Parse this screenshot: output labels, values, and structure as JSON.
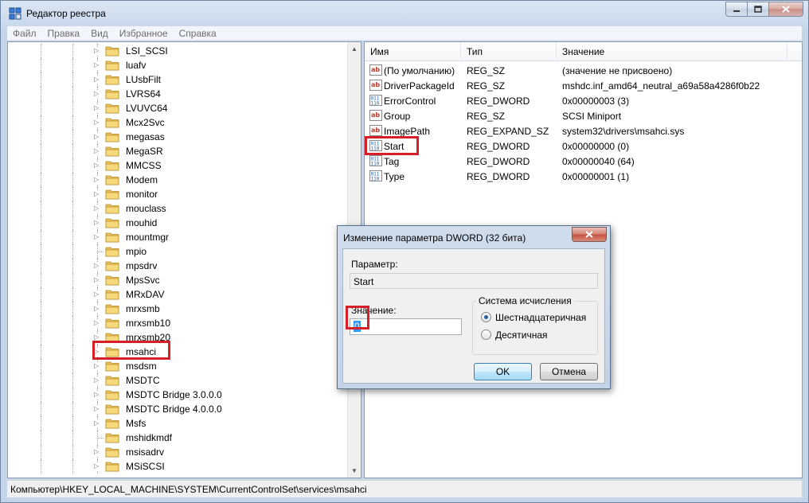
{
  "window": {
    "title": "Редактор реестра",
    "buttons": [
      "minimize",
      "maximize",
      "close"
    ]
  },
  "menu": [
    "Файл",
    "Правка",
    "Вид",
    "Избранное",
    "Справка"
  ],
  "tree": {
    "items": [
      {
        "label": "LSI_SCSI",
        "expandable": true
      },
      {
        "label": "luafv",
        "expandable": true
      },
      {
        "label": "LUsbFilt",
        "expandable": true
      },
      {
        "label": "LVRS64",
        "expandable": true
      },
      {
        "label": "LVUVC64",
        "expandable": true
      },
      {
        "label": "Mcx2Svc",
        "expandable": true
      },
      {
        "label": "megasas",
        "expandable": true
      },
      {
        "label": "MegaSR",
        "expandable": true
      },
      {
        "label": "MMCSS",
        "expandable": true
      },
      {
        "label": "Modem",
        "expandable": true
      },
      {
        "label": "monitor",
        "expandable": true
      },
      {
        "label": "mouclass",
        "expandable": true
      },
      {
        "label": "mouhid",
        "expandable": true
      },
      {
        "label": "mountmgr",
        "expandable": true
      },
      {
        "label": "mpio",
        "expandable": false
      },
      {
        "label": "mpsdrv",
        "expandable": true
      },
      {
        "label": "MpsSvc",
        "expandable": true
      },
      {
        "label": "MRxDAV",
        "expandable": true
      },
      {
        "label": "mrxsmb",
        "expandable": true
      },
      {
        "label": "mrxsmb10",
        "expandable": true
      },
      {
        "label": "mrxsmb20",
        "expandable": true
      },
      {
        "label": "msahci",
        "expandable": true,
        "selected": true
      },
      {
        "label": "msdsm",
        "expandable": true
      },
      {
        "label": "MSDTC",
        "expandable": true
      },
      {
        "label": "MSDTC Bridge 3.0.0.0",
        "expandable": true
      },
      {
        "label": "MSDTC Bridge 4.0.0.0",
        "expandable": true
      },
      {
        "label": "Msfs",
        "expandable": true
      },
      {
        "label": "mshidkmdf",
        "expandable": false
      },
      {
        "label": "msisadrv",
        "expandable": true
      },
      {
        "label": "MSiSCSI",
        "expandable": true
      }
    ]
  },
  "list": {
    "columns": [
      "Имя",
      "Тип",
      "Значение"
    ],
    "rows": [
      {
        "icon": "string-value-icon",
        "name": "(По умолчанию)",
        "type": "REG_SZ",
        "value": "(значение не присвоено)"
      },
      {
        "icon": "string-value-icon",
        "name": "DriverPackageId",
        "type": "REG_SZ",
        "value": "mshdc.inf_amd64_neutral_a69a58a4286f0b22"
      },
      {
        "icon": "binary-value-icon",
        "name": "ErrorControl",
        "type": "REG_DWORD",
        "value": "0x00000003 (3)"
      },
      {
        "icon": "string-value-icon",
        "name": "Group",
        "type": "REG_SZ",
        "value": "SCSI Miniport"
      },
      {
        "icon": "string-value-icon",
        "name": "ImagePath",
        "type": "REG_EXPAND_SZ",
        "value": "system32\\drivers\\msahci.sys"
      },
      {
        "icon": "binary-value-icon",
        "name": "Start",
        "type": "REG_DWORD",
        "value": "0x00000000 (0)",
        "highlighted": true
      },
      {
        "icon": "binary-value-icon",
        "name": "Tag",
        "type": "REG_DWORD",
        "value": "0x00000040 (64)"
      },
      {
        "icon": "binary-value-icon",
        "name": "Type",
        "type": "REG_DWORD",
        "value": "0x00000001 (1)"
      }
    ]
  },
  "status": {
    "path": "Компьютер\\HKEY_LOCAL_MACHINE\\SYSTEM\\CurrentControlSet\\services\\msahci"
  },
  "dialog": {
    "title": "Изменение параметра DWORD (32 бита)",
    "param_label": "Параметр:",
    "param_value": "Start",
    "value_label": "Значение:",
    "value": "0",
    "radix_label": "Система исчисления",
    "radix_options": [
      {
        "label": "Шестнадцатеричная",
        "checked": true
      },
      {
        "label": "Десятичная",
        "checked": false
      }
    ],
    "ok_label": "OK",
    "cancel_label": "Отмена"
  },
  "colors": {
    "highlight": "#d5202a",
    "selection": "#3399ff"
  }
}
